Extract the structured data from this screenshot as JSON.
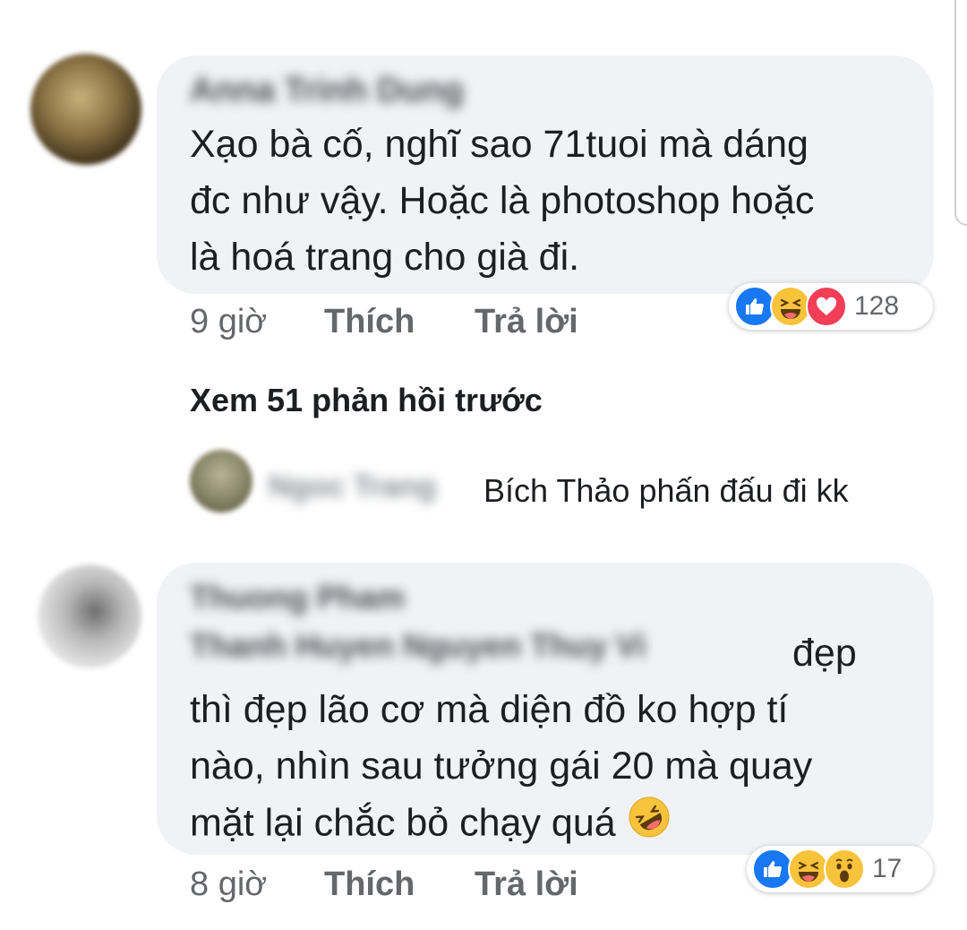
{
  "comment1": {
    "author": "Anna Trinh Dung",
    "lines": [
      "Xạo bà cố, nghĩ sao 71tuoi mà dáng",
      "đc như vậy. Hoặc là photoshop hoặc",
      "là hoá trang cho già đi."
    ],
    "time": "9 giờ",
    "like_label": "Thích",
    "reply_label": "Trả lời",
    "reaction_count": "128",
    "reactions": [
      "like-icon",
      "haha-icon",
      "love-icon"
    ]
  },
  "view_previous": "Xem 51 phản hồi trước",
  "reply1": {
    "author": "Ngoc Trang",
    "text": "Bích Thảo phấn đấu đi kk"
  },
  "comment2": {
    "author": "Thuong Pham",
    "tagged": "Thanh Huyen Nguyen Thuy Vi",
    "first_line_suffix": "đẹp",
    "lines": [
      "thì đẹp lão cơ mà diện đồ ko hợp tí",
      "nào, nhìn sau tưởng gái 20 mà quay",
      "mặt lại chắc bỏ chạy quá"
    ],
    "time": "8 giờ",
    "like_label": "Thích",
    "reply_label": "Trả lời",
    "reaction_count": "17",
    "reactions": [
      "like-icon",
      "haha-icon",
      "wow-icon"
    ]
  },
  "colors": {
    "bubble": "#f0f2f5",
    "like_blue": "#1877f2",
    "love_red": "#f33e58",
    "emoji_yellow": "#f7c33b",
    "meta_gray": "#65676b"
  }
}
